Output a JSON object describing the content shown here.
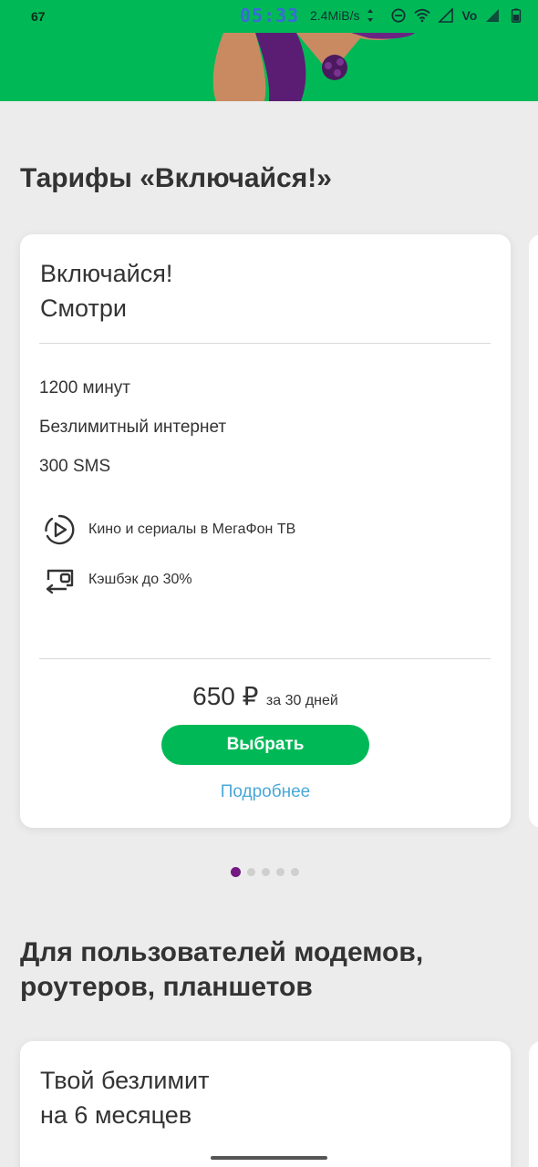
{
  "status_bar": {
    "left_text": "67",
    "time": "05:33",
    "speed": "2.4MiB/s",
    "icons": [
      "data-arrows-icon",
      "dnd-icon",
      "wifi-icon",
      "signal-icon",
      "volte-icon",
      "signal-icon-2",
      "battery-icon"
    ],
    "volte_label": "Vo"
  },
  "colors": {
    "brand_green": "#00b956",
    "brand_purple": "#731982",
    "link_blue": "#4aa8d8",
    "background": "#ececec"
  },
  "section1": {
    "title": "Тарифы «Включайся!»",
    "card": {
      "name_line1": "Включайся!",
      "name_line2": "Смотри",
      "features": [
        "1200 минут",
        "Безлимитный интернет",
        "300 SMS"
      ],
      "options": [
        {
          "icon": "play-circle-icon",
          "label": "Кино и сериалы в МегаФон ТВ"
        },
        {
          "icon": "cashback-icon",
          "label": "Кэшбэк до 30%"
        }
      ],
      "price": "650 ₽",
      "period": "за 30 дней",
      "button": "Выбрать",
      "link": "Подробнее"
    },
    "pagination": {
      "total": 5,
      "active": 0
    }
  },
  "section2": {
    "title": "Для пользователей модемов, роутеров, планшетов",
    "card": {
      "name_line1": "Твой безлимит",
      "name_line2": "на 6 месяцев"
    }
  }
}
